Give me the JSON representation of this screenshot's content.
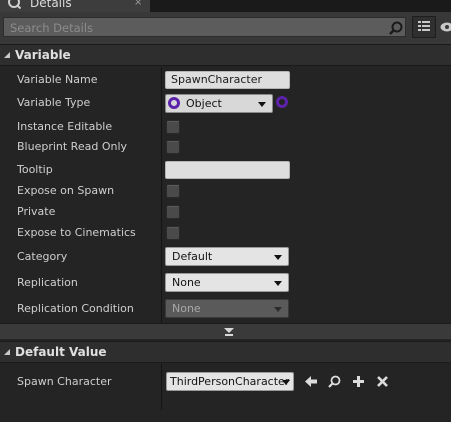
{
  "tab": {
    "title": "Details",
    "close_glyph": "×",
    "icon": "details-icon"
  },
  "search": {
    "placeholder": "Search Details",
    "value": ""
  },
  "variable_category": {
    "title": "Variable",
    "variable_name": {
      "label": "Variable Name",
      "value": "SpawnCharacter"
    },
    "variable_type": {
      "label": "Variable Type",
      "value": "Object",
      "pin_color": "#5c22aa"
    },
    "instance_editable": {
      "label": "Instance Editable",
      "checked": false
    },
    "blueprint_read_only": {
      "label": "Blueprint Read Only",
      "checked": false
    },
    "tooltip": {
      "label": "Tooltip",
      "value": ""
    },
    "expose_on_spawn": {
      "label": "Expose on Spawn",
      "checked": false
    },
    "private": {
      "label": "Private",
      "checked": false
    },
    "expose_to_cinematics": {
      "label": "Expose to Cinematics",
      "checked": false
    },
    "category": {
      "label": "Category",
      "value": "Default"
    },
    "replication": {
      "label": "Replication",
      "value": "None"
    },
    "replication_condition": {
      "label": "Replication Condition",
      "value": "None",
      "enabled": false
    }
  },
  "default_value_category": {
    "title": "Default Value",
    "spawn_character": {
      "label": "Spawn Character",
      "value": "ThirdPersonCharacter",
      "actions": [
        "use-selected-arrow-icon",
        "browse-magnifier-icon",
        "add-plus-icon",
        "clear-x-icon"
      ]
    }
  },
  "colors": {
    "background": "#242424",
    "header": "#2e2e2e",
    "object_pin": "#5c22aa"
  }
}
